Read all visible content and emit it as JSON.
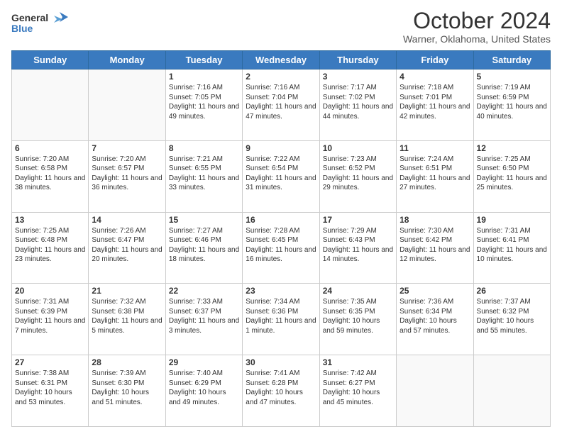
{
  "header": {
    "logo_line1": "General",
    "logo_line2": "Blue",
    "title": "October 2024",
    "location": "Warner, Oklahoma, United States"
  },
  "weekdays": [
    "Sunday",
    "Monday",
    "Tuesday",
    "Wednesday",
    "Thursday",
    "Friday",
    "Saturday"
  ],
  "weeks": [
    [
      {
        "day": "",
        "sunrise": "",
        "sunset": "",
        "daylight": ""
      },
      {
        "day": "",
        "sunrise": "",
        "sunset": "",
        "daylight": ""
      },
      {
        "day": "1",
        "sunrise": "Sunrise: 7:16 AM",
        "sunset": "Sunset: 7:05 PM",
        "daylight": "Daylight: 11 hours and 49 minutes."
      },
      {
        "day": "2",
        "sunrise": "Sunrise: 7:16 AM",
        "sunset": "Sunset: 7:04 PM",
        "daylight": "Daylight: 11 hours and 47 minutes."
      },
      {
        "day": "3",
        "sunrise": "Sunrise: 7:17 AM",
        "sunset": "Sunset: 7:02 PM",
        "daylight": "Daylight: 11 hours and 44 minutes."
      },
      {
        "day": "4",
        "sunrise": "Sunrise: 7:18 AM",
        "sunset": "Sunset: 7:01 PM",
        "daylight": "Daylight: 11 hours and 42 minutes."
      },
      {
        "day": "5",
        "sunrise": "Sunrise: 7:19 AM",
        "sunset": "Sunset: 6:59 PM",
        "daylight": "Daylight: 11 hours and 40 minutes."
      }
    ],
    [
      {
        "day": "6",
        "sunrise": "Sunrise: 7:20 AM",
        "sunset": "Sunset: 6:58 PM",
        "daylight": "Daylight: 11 hours and 38 minutes."
      },
      {
        "day": "7",
        "sunrise": "Sunrise: 7:20 AM",
        "sunset": "Sunset: 6:57 PM",
        "daylight": "Daylight: 11 hours and 36 minutes."
      },
      {
        "day": "8",
        "sunrise": "Sunrise: 7:21 AM",
        "sunset": "Sunset: 6:55 PM",
        "daylight": "Daylight: 11 hours and 33 minutes."
      },
      {
        "day": "9",
        "sunrise": "Sunrise: 7:22 AM",
        "sunset": "Sunset: 6:54 PM",
        "daylight": "Daylight: 11 hours and 31 minutes."
      },
      {
        "day": "10",
        "sunrise": "Sunrise: 7:23 AM",
        "sunset": "Sunset: 6:52 PM",
        "daylight": "Daylight: 11 hours and 29 minutes."
      },
      {
        "day": "11",
        "sunrise": "Sunrise: 7:24 AM",
        "sunset": "Sunset: 6:51 PM",
        "daylight": "Daylight: 11 hours and 27 minutes."
      },
      {
        "day": "12",
        "sunrise": "Sunrise: 7:25 AM",
        "sunset": "Sunset: 6:50 PM",
        "daylight": "Daylight: 11 hours and 25 minutes."
      }
    ],
    [
      {
        "day": "13",
        "sunrise": "Sunrise: 7:25 AM",
        "sunset": "Sunset: 6:48 PM",
        "daylight": "Daylight: 11 hours and 23 minutes."
      },
      {
        "day": "14",
        "sunrise": "Sunrise: 7:26 AM",
        "sunset": "Sunset: 6:47 PM",
        "daylight": "Daylight: 11 hours and 20 minutes."
      },
      {
        "day": "15",
        "sunrise": "Sunrise: 7:27 AM",
        "sunset": "Sunset: 6:46 PM",
        "daylight": "Daylight: 11 hours and 18 minutes."
      },
      {
        "day": "16",
        "sunrise": "Sunrise: 7:28 AM",
        "sunset": "Sunset: 6:45 PM",
        "daylight": "Daylight: 11 hours and 16 minutes."
      },
      {
        "day": "17",
        "sunrise": "Sunrise: 7:29 AM",
        "sunset": "Sunset: 6:43 PM",
        "daylight": "Daylight: 11 hours and 14 minutes."
      },
      {
        "day": "18",
        "sunrise": "Sunrise: 7:30 AM",
        "sunset": "Sunset: 6:42 PM",
        "daylight": "Daylight: 11 hours and 12 minutes."
      },
      {
        "day": "19",
        "sunrise": "Sunrise: 7:31 AM",
        "sunset": "Sunset: 6:41 PM",
        "daylight": "Daylight: 11 hours and 10 minutes."
      }
    ],
    [
      {
        "day": "20",
        "sunrise": "Sunrise: 7:31 AM",
        "sunset": "Sunset: 6:39 PM",
        "daylight": "Daylight: 11 hours and 7 minutes."
      },
      {
        "day": "21",
        "sunrise": "Sunrise: 7:32 AM",
        "sunset": "Sunset: 6:38 PM",
        "daylight": "Daylight: 11 hours and 5 minutes."
      },
      {
        "day": "22",
        "sunrise": "Sunrise: 7:33 AM",
        "sunset": "Sunset: 6:37 PM",
        "daylight": "Daylight: 11 hours and 3 minutes."
      },
      {
        "day": "23",
        "sunrise": "Sunrise: 7:34 AM",
        "sunset": "Sunset: 6:36 PM",
        "daylight": "Daylight: 11 hours and 1 minute."
      },
      {
        "day": "24",
        "sunrise": "Sunrise: 7:35 AM",
        "sunset": "Sunset: 6:35 PM",
        "daylight": "Daylight: 10 hours and 59 minutes."
      },
      {
        "day": "25",
        "sunrise": "Sunrise: 7:36 AM",
        "sunset": "Sunset: 6:34 PM",
        "daylight": "Daylight: 10 hours and 57 minutes."
      },
      {
        "day": "26",
        "sunrise": "Sunrise: 7:37 AM",
        "sunset": "Sunset: 6:32 PM",
        "daylight": "Daylight: 10 hours and 55 minutes."
      }
    ],
    [
      {
        "day": "27",
        "sunrise": "Sunrise: 7:38 AM",
        "sunset": "Sunset: 6:31 PM",
        "daylight": "Daylight: 10 hours and 53 minutes."
      },
      {
        "day": "28",
        "sunrise": "Sunrise: 7:39 AM",
        "sunset": "Sunset: 6:30 PM",
        "daylight": "Daylight: 10 hours and 51 minutes."
      },
      {
        "day": "29",
        "sunrise": "Sunrise: 7:40 AM",
        "sunset": "Sunset: 6:29 PM",
        "daylight": "Daylight: 10 hours and 49 minutes."
      },
      {
        "day": "30",
        "sunrise": "Sunrise: 7:41 AM",
        "sunset": "Sunset: 6:28 PM",
        "daylight": "Daylight: 10 hours and 47 minutes."
      },
      {
        "day": "31",
        "sunrise": "Sunrise: 7:42 AM",
        "sunset": "Sunset: 6:27 PM",
        "daylight": "Daylight: 10 hours and 45 minutes."
      },
      {
        "day": "",
        "sunrise": "",
        "sunset": "",
        "daylight": ""
      },
      {
        "day": "",
        "sunrise": "",
        "sunset": "",
        "daylight": ""
      }
    ]
  ]
}
